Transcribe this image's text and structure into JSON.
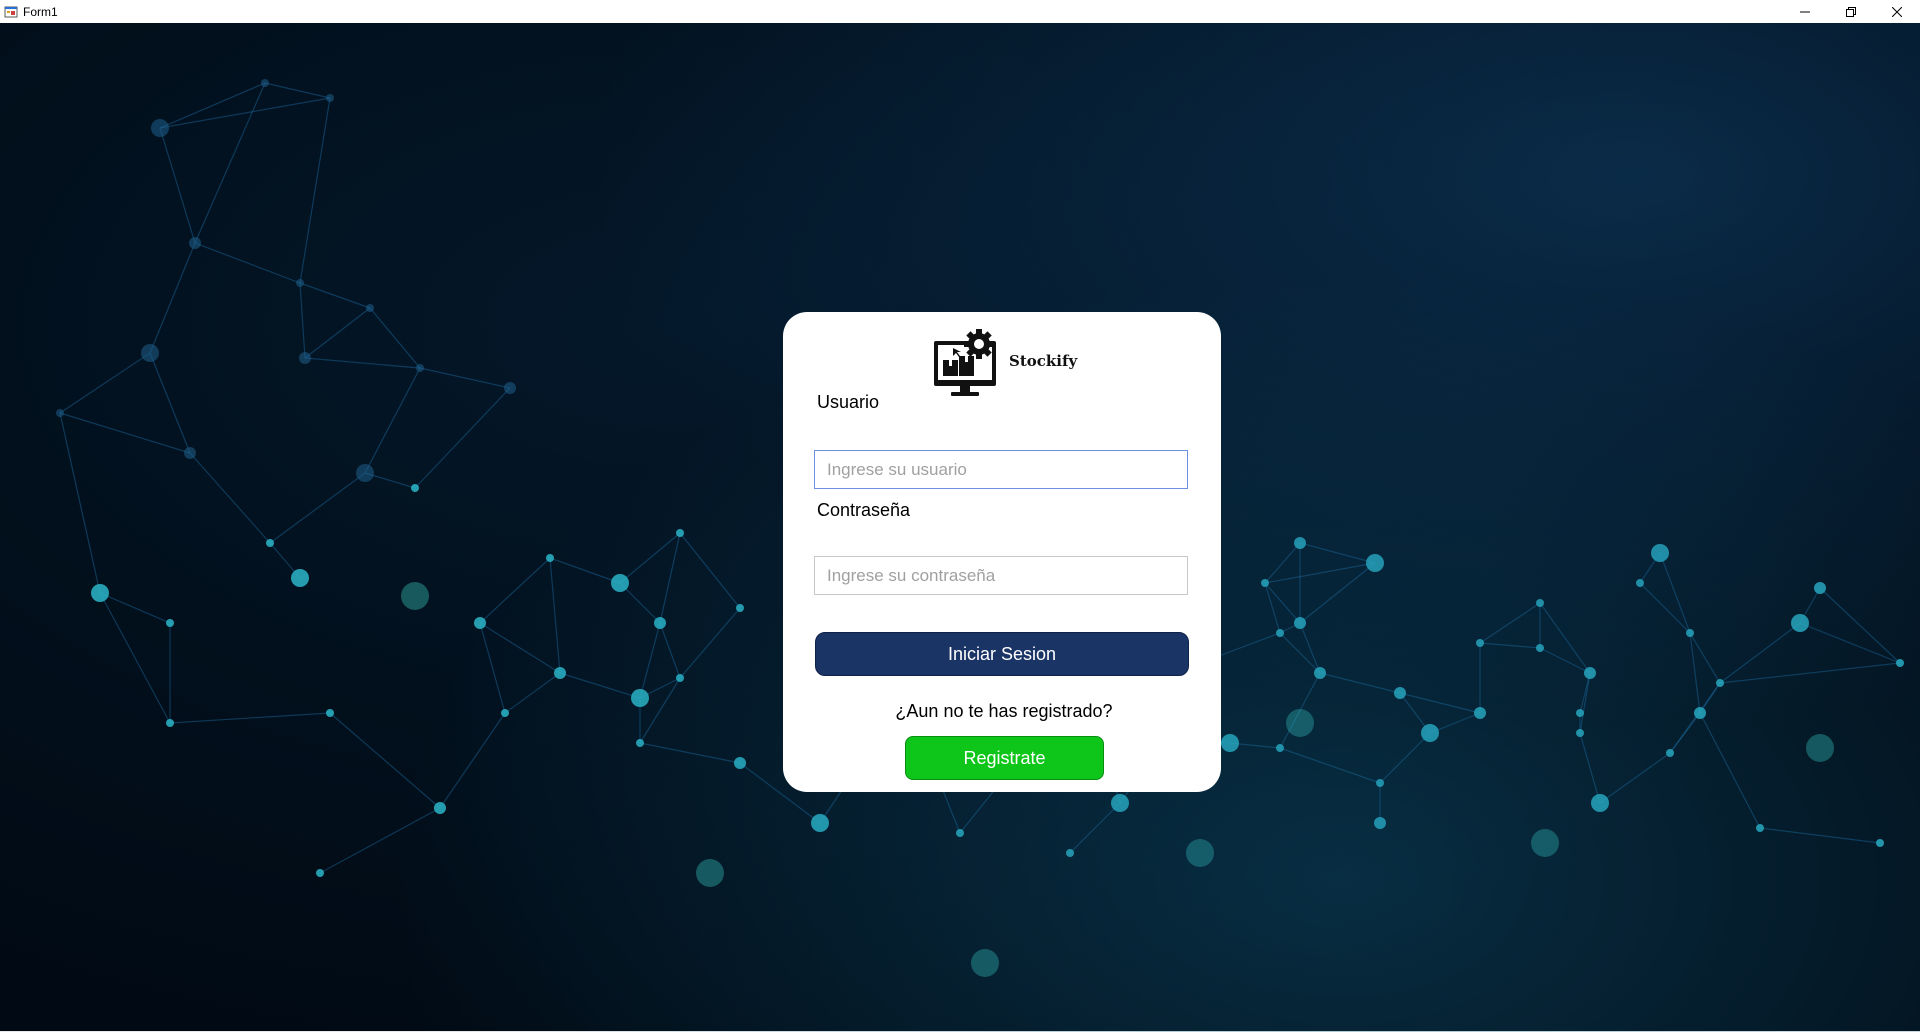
{
  "window": {
    "title": "Form1",
    "controls": {
      "minimize": "–",
      "maximize": "❐",
      "close": "✕"
    }
  },
  "brand": {
    "name": "Stockify",
    "logo_icon": "monitor-with-boxes-and-gear-icon"
  },
  "login": {
    "username_label": "Usuario",
    "username_placeholder": "Ingrese su usuario",
    "username_value": "",
    "password_label": "Contraseña",
    "password_placeholder": "Ingrese su contraseña",
    "password_value": "",
    "login_button": "Iniciar Sesion",
    "register_question": "¿Aun no te has registrado?",
    "register_button": "Registrate"
  },
  "colors": {
    "login_button": "#1a3466",
    "register_button": "#0ec51a",
    "background": "#020c18",
    "network_accent": "#2fd0c8"
  }
}
